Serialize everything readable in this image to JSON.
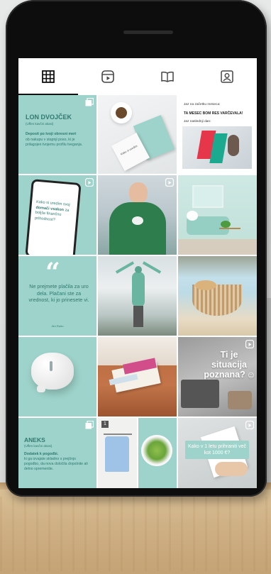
{
  "colors": {
    "accent": "#9dd3ca",
    "accent_dark": "#2f7a70",
    "white": "#ffffff"
  },
  "tabs": [
    {
      "icon": "grid-icon",
      "active": true
    },
    {
      "icon": "reels-icon",
      "active": false
    },
    {
      "icon": "guide-book-icon",
      "active": false
    },
    {
      "icon": "tagged-user-icon",
      "active": false
    }
  ],
  "posts": {
    "lon_dvojcek": {
      "title": "LON DVOJČEK",
      "subtitle": "(Uffen kavčni akasi)",
      "body_bold": "Deposit po tvoji obresni meri",
      "body": "ob nakupu v stapnji poso, ki je prilagojen tvojemu profilu tveganja."
    },
    "notebook": {
      "caption": "Kako si uredim"
    },
    "news_tile": {
      "line1": "Jaz na začetku meseca:",
      "line2": "TA MESEC BOM RES VARČEVALA!",
      "line3": "Jaz naslednji dan:"
    },
    "phone_tile": {
      "text_normal": "Kako si uredim svoj ",
      "text_bold": "domači vsakon",
      "text_tail": " za boljše finančno prihodnost?"
    },
    "quote_tile": {
      "mark": "“",
      "text": "Ne prejmete plačila za uro dela. Plačani ste za vrednost, ki jo prinesete vi.",
      "author": "Jim Rohn"
    },
    "situation_tile": {
      "text": "Ti je situacija poznana?",
      "emoji": "😉"
    },
    "aneks_tile": {
      "title": "ANEKS",
      "subtitle": "(Uffen kavčni akasi)",
      "body_bold": "Dodatek k pogodbi.",
      "body": "ki ga izvajate skladno s prejšnjo pogodbo, da nova določila dopolnite ali delno spremenite."
    },
    "salary_tile": {
      "text": "Kako v 1 letu prihraniti več kot 1000 €?"
    },
    "number_badge": "1"
  }
}
